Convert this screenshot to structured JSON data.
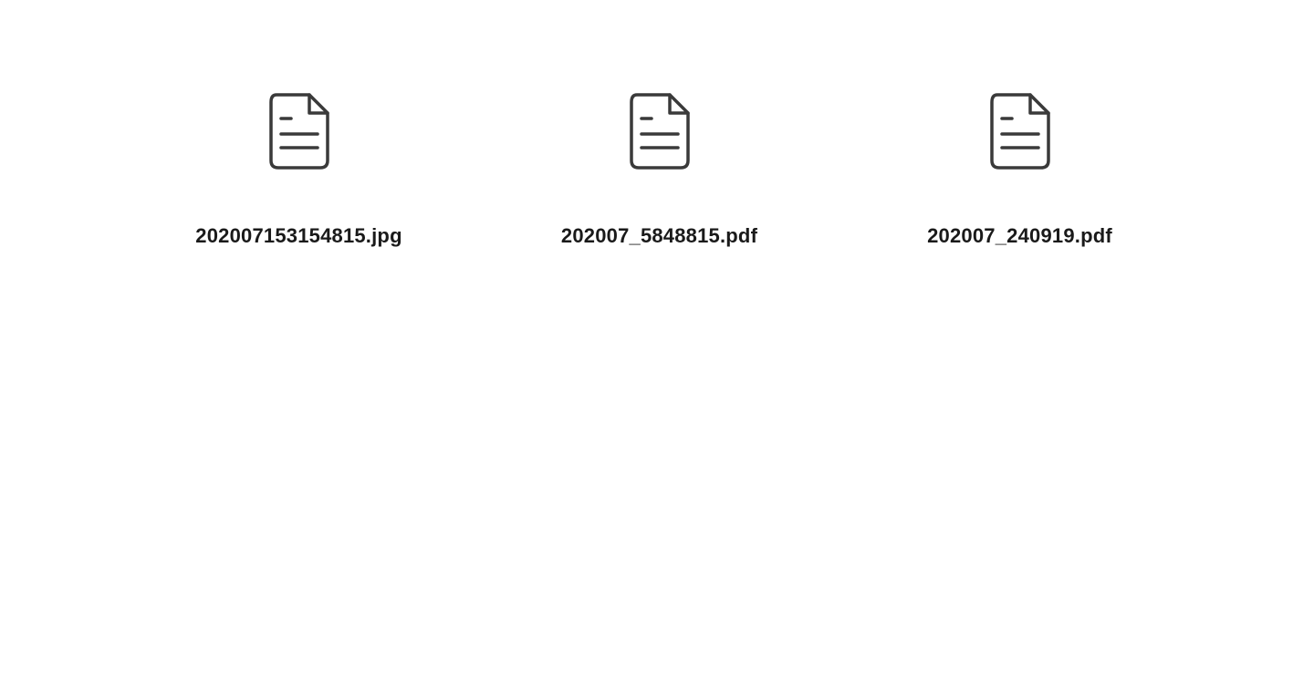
{
  "files": [
    {
      "name": "202007153154815.jpg"
    },
    {
      "name": "202007_5848815.pdf"
    },
    {
      "name": "202007_240919.pdf"
    }
  ]
}
